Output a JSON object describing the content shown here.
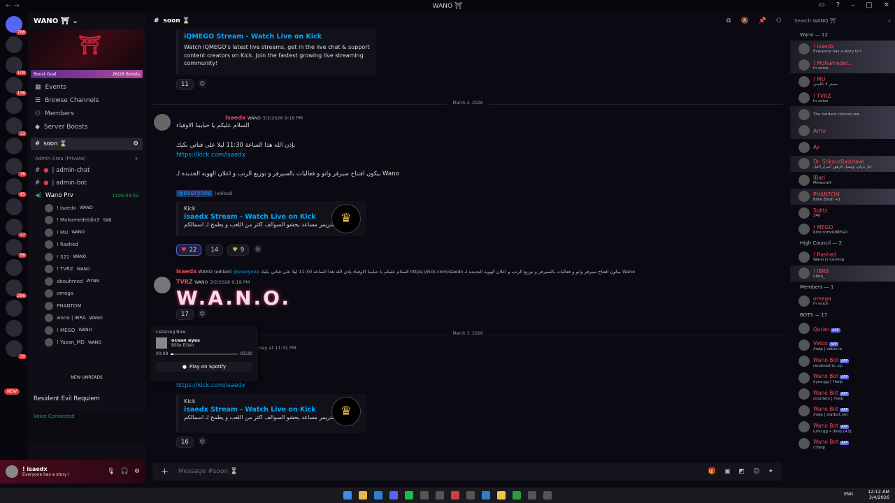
{
  "window": {
    "title": "WANO ⛩",
    "controls": [
      "▭",
      "?",
      "–",
      "□",
      "✕"
    ]
  },
  "rail": {
    "badges": [
      "786",
      "109",
      "136",
      "33",
      "76",
      "45",
      "37",
      "58",
      "296",
      "30"
    ],
    "new_label": "NEW"
  },
  "server": {
    "name": "WANO ⛩",
    "boost_label": "Boost Goal",
    "boost_count": "26/28 Boosts"
  },
  "side_items": [
    "Events",
    "Browse Channels",
    "Members",
    "Server Boosts"
  ],
  "channels": {
    "soon": "soon ⌛",
    "admin_cat": "Admin Area (Private)",
    "admin_chat": "| admin-chat",
    "admin_bot": "| admin-bot",
    "voice": "Wano Prv",
    "voice_time": "1106:04:02"
  },
  "voice_users": [
    "! isaedx",
    "! Mohamedeldin3",
    "! MU",
    "! Rashed",
    "! S21",
    "! TVRZ",
    "abouhmed",
    "omega",
    "PHANTOM",
    "wano | IBRA",
    "! MEGO",
    "! Yazan_MD"
  ],
  "voice_tags": [
    "WANO",
    "SXB",
    "WANO",
    "",
    "WANO",
    "WANO",
    "WYNN",
    "",
    "",
    "WANO",
    "WANO",
    "WANO"
  ],
  "new_unreads": "NEW UNREADS",
  "now_playing_game": "Resident Evil Requiem",
  "voice_connected": "Voice Connected",
  "user": {
    "name": "! isaedx",
    "status": "Everyone has a story !"
  },
  "header": {
    "channel": "soon ⌛"
  },
  "embed1": {
    "title": "iQMEGO Stream - Watch Live on Kick",
    "text": "Watch iQMEGO's latest live streams, get in the live chat & support content creators on Kick. Join the fastest growing live streaming community!",
    "reaction": "11"
  },
  "date1": "March 2, 2026",
  "msg1": {
    "user": "isaedx",
    "tag": "WANO",
    "time": "3/2/2026 9:18 PM",
    "l1": "السلام عليكم يا حبايبنا الاوفياء",
    "l2": "بإذن الله هذا الساعة 11:30 ليلا على قناتي بكيك",
    "link": "https://kick.com/isaedx",
    "l3": "بيكون افتتاح سيرفر وانو و فعاليات بالسيرفر و توزيع الرتب و اعلان الهويه الجديده لـ Wano",
    "mention": "@everyone",
    "edited": "(edited)"
  },
  "embed2": {
    "provider": "Kick",
    "title": "isaedx Stream - Watch Live on Kick",
    "text": "ستريمر مساعد يحشو السوالف اكثر من اللعب و يطمح لـ اسمالكم",
    "r1": "22",
    "r2": "14",
    "r3": "9"
  },
  "reply": {
    "user": "isaedx",
    "tag": "WANO",
    "edited": "(edited)",
    "mention": "@everyone",
    "text": "السلام عليكم يا حبايبنا الاوفياء بإذن الله هذا الساعة 11:30 ليلا على قناتي بكيك https://kick.com/isaedx بيكون افتتاح سيرفر وانو و فعاليات بالسيرفر و توزيع الرتب و اعلان الهويه الجديده لـ Wano"
  },
  "msg2": {
    "user": "TVRZ",
    "tag": "WANO",
    "time": "3/2/2026 9:19 PM",
    "big": "W.A.N.O.",
    "reaction": "17"
  },
  "date2": "March 3, 2026",
  "msg3": {
    "time": "rday at 11:32 PM",
    "link": "https://kick.com/isaedx",
    "reaction": "16"
  },
  "embed3": {
    "provider": "Kick",
    "title": "isaedx Stream - Watch Live on Kick",
    "text": "ستريمر مساعد يحشو السوالف اكثر من اللعب و يطمح لـ اسمالكم"
  },
  "popup": {
    "label": "Listening Now",
    "song": "ocean eyes",
    "artist": "Billie Eilish",
    "t0": "00:08",
    "t1": "03:20",
    "button": "Play on Spotify",
    "progress": 0.04
  },
  "input": {
    "placeholder": "Message #soon ⌛"
  },
  "search": {
    "placeholder": "Search WANO ⛩"
  },
  "member_groups": [
    {
      "title": "Wano — 12",
      "items": [
        {
          "n": "! isaedx",
          "s": "Everyone has a story to t",
          "hl": true
        },
        {
          "n": "! Mohamedel...",
          "s": "In voice",
          "hl": true
        },
        {
          "n": "! MU",
          "s": "مستر لا تكلمني",
          "hl": false
        },
        {
          "n": "! TVRZ",
          "s": "In voice",
          "hl": false
        },
        {
          "n": "",
          "s": "The hardest choices req",
          "hl": true
        },
        {
          "n": "Arrio",
          "s": "",
          "hl": true
        },
        {
          "n": "Ay",
          "s": "",
          "hl": false
        },
        {
          "n": "Dr. ShkourBashtawi",
          "s": "جاز برقي، وتيمبل الزهور أسرار الليل",
          "hl": true
        },
        {
          "n": "IBari",
          "s": "Minecraft",
          "hl": false
        },
        {
          "n": "PHANTOM",
          "s": "Billie Eilish +1",
          "hl": true
        },
        {
          "n": "Splitz",
          "s": "340",
          "hl": false
        },
        {
          "n": "! MEGO",
          "s": "Kick.com/iQMEGO",
          "hl": false
        }
      ]
    },
    {
      "title": "High Council — 2",
      "items": [
        {
          "n": "! Rashed",
          "s": "Wano is Coming",
          "hl": false
        },
        {
          "n": "! IBRA",
          "s": "ulbra_",
          "hl": true
        }
      ]
    },
    {
      "title": "Members — 1",
      "items": [
        {
          "n": "omega",
          "s": "In voice",
          "hl": false
        }
      ]
    },
    {
      "title": "BOTS — 17",
      "items": [
        {
          "n": "Quran",
          "s": "",
          "hl": false
        },
        {
          "n": "Vetox",
          "s": "/help | vetox.io",
          "hl": false
        },
        {
          "n": "Wano Bot",
          "s": "renamed to .cp",
          "hl": false
        },
        {
          "n": "Wano Bot",
          "s": "dyno.gg | ?help",
          "hl": false
        },
        {
          "n": "Wano Bot",
          "s": "counters | /help",
          "hl": false
        },
        {
          "n": "Wano Bot",
          "s": "/help | statbot.net",
          "hl": false
        },
        {
          "n": "Wano Bot",
          "s": "lurkr.gg • /help [43]",
          "hl": false
        },
        {
          "n": "Wano Bot",
          "s": "c!help",
          "hl": false
        }
      ]
    }
  ],
  "app_tag": "APP",
  "clock": {
    "time": "12:12 AM",
    "date": "3/4/2026",
    "lang": "ENG"
  }
}
